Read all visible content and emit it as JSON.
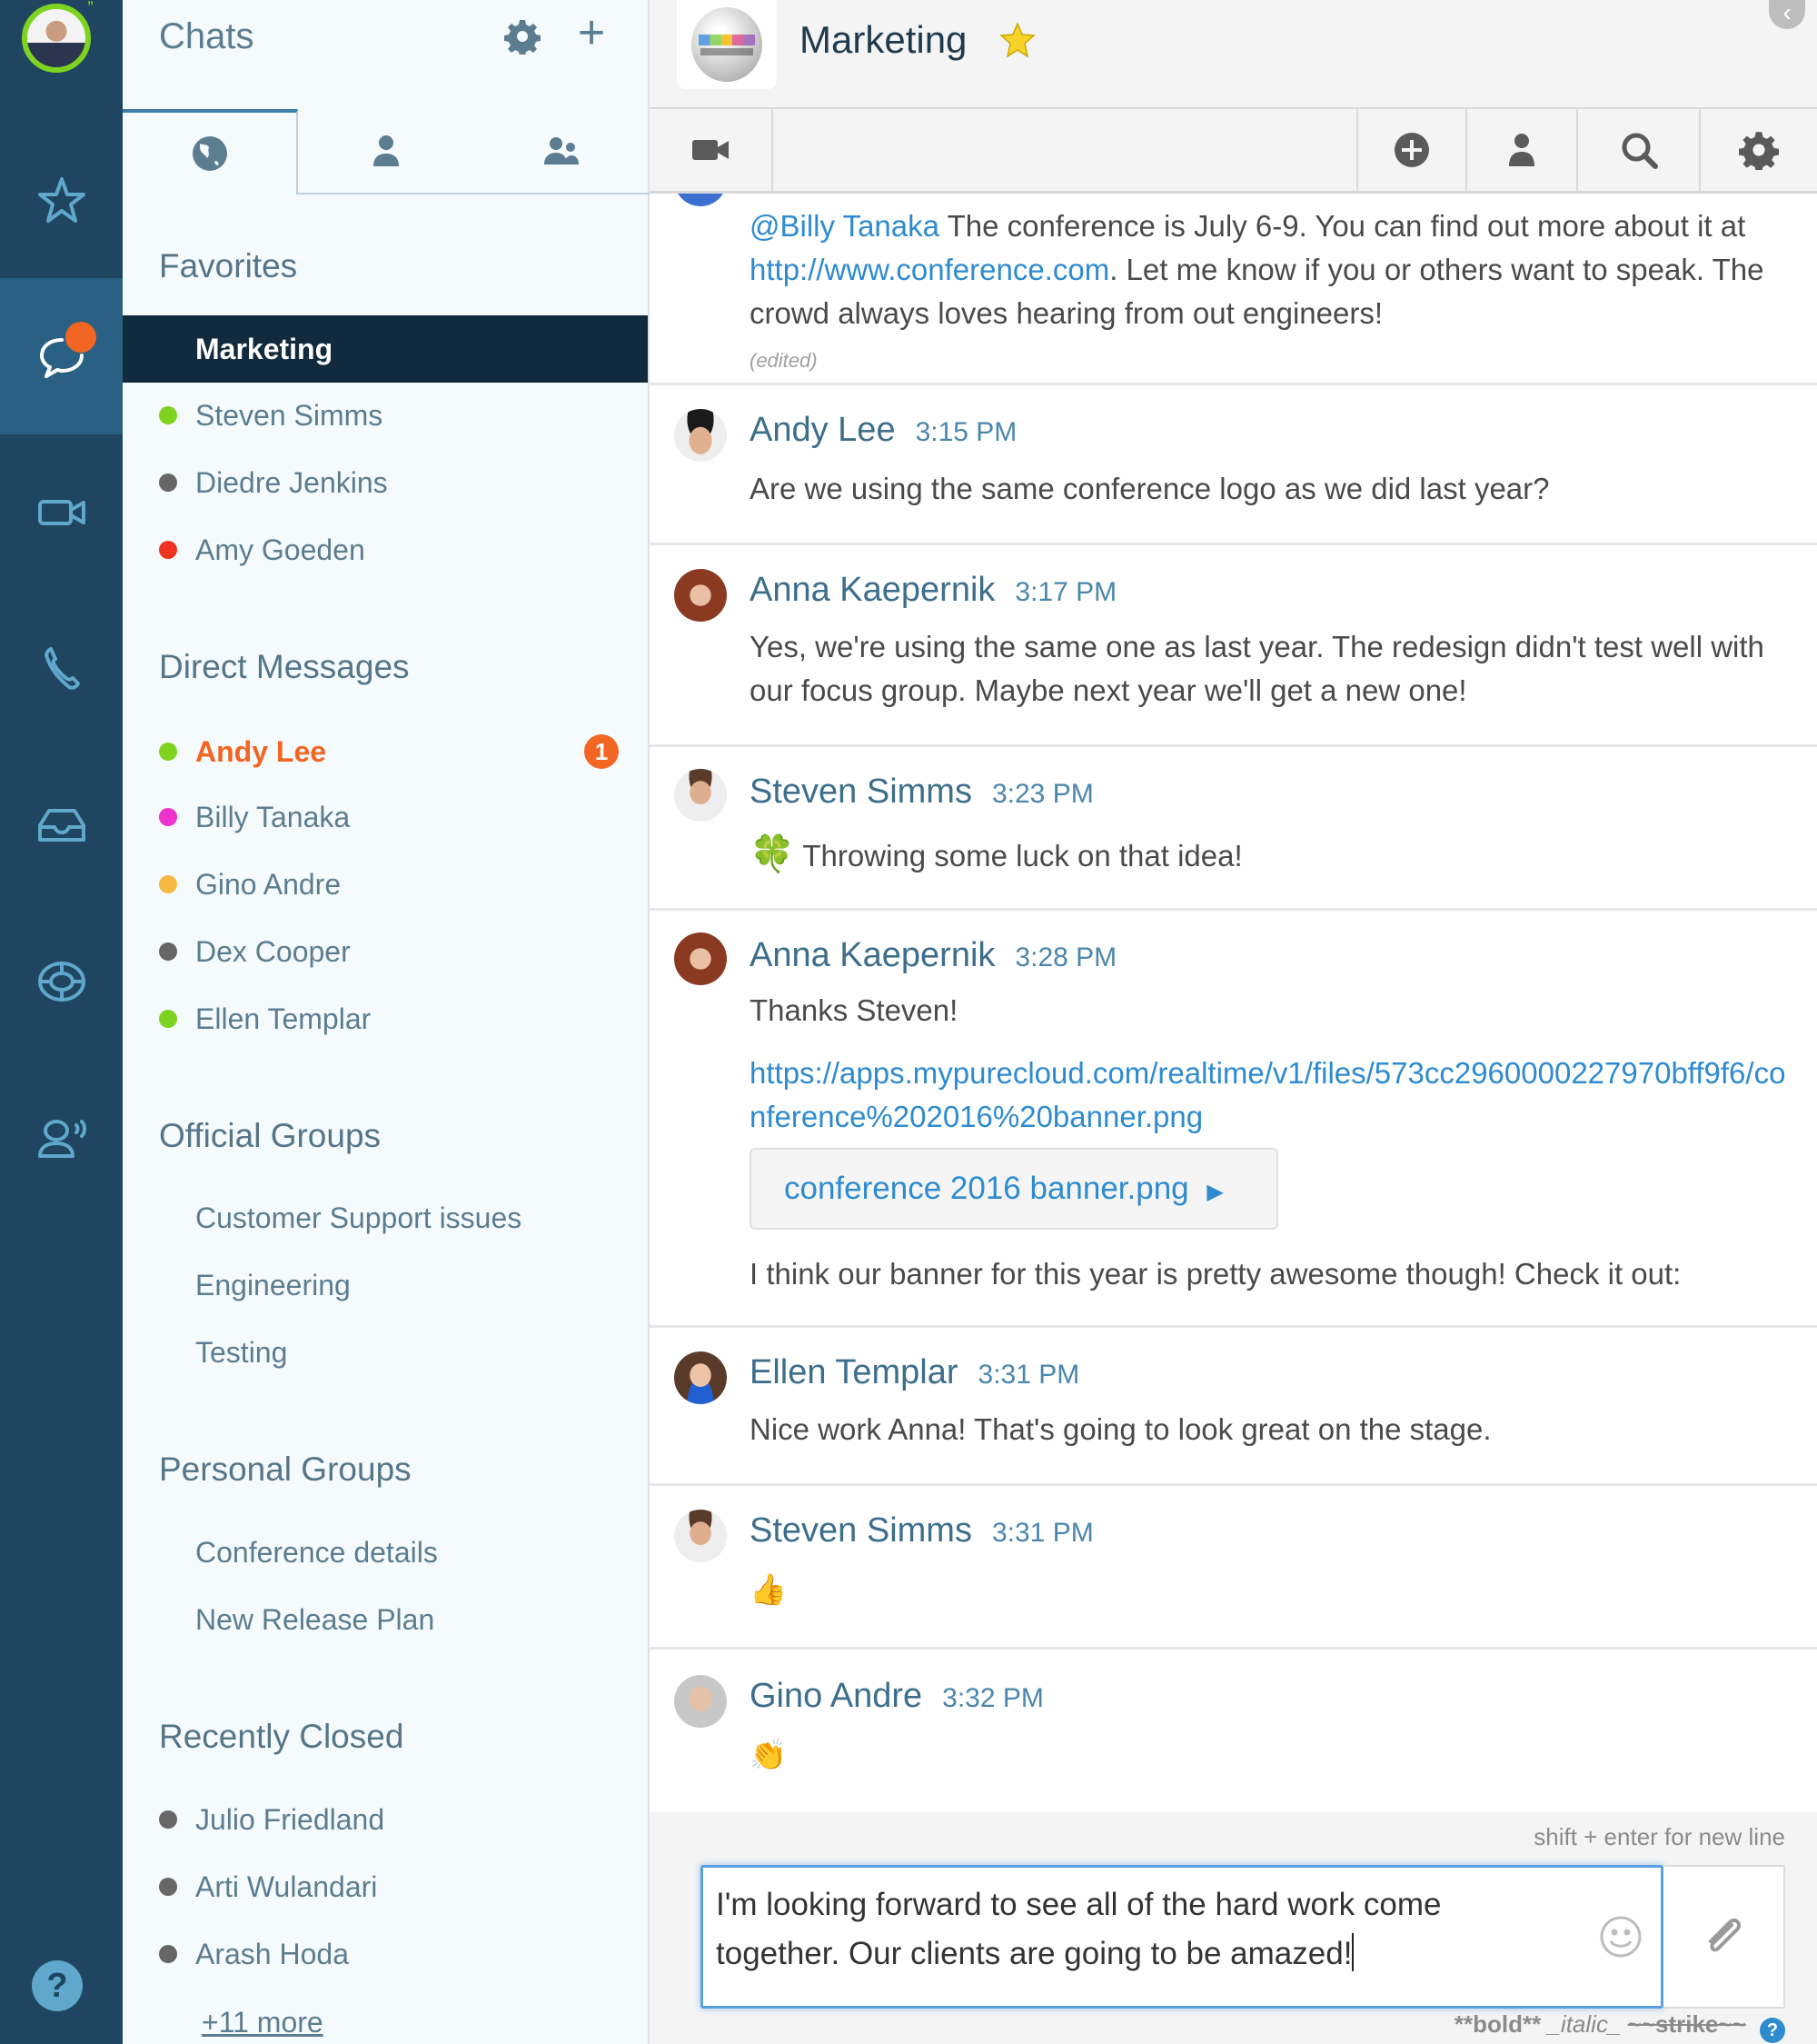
{
  "colors": {
    "rail_bg": "#1f4560",
    "rail_active": "#2a6084",
    "sidebar_bg": "#f5fafd",
    "selected_row": "#122a3d",
    "accent_orange": "#f26522",
    "link_blue": "#2e8bd0",
    "presence_available": "#7ed321",
    "presence_offline": "#666666",
    "presence_busy": "#ee3322",
    "presence_meal": "#f5b942",
    "presence_custom": "#ee33cc"
  },
  "rail": {
    "items": [
      {
        "name": "favorites",
        "icon": "star-icon"
      },
      {
        "name": "chats",
        "icon": "chat-bubble-icon",
        "active": true,
        "has_notification": true
      },
      {
        "name": "video",
        "icon": "video-camera-icon"
      },
      {
        "name": "phone",
        "icon": "phone-icon"
      },
      {
        "name": "inbox",
        "icon": "inbox-tray-icon"
      },
      {
        "name": "support",
        "icon": "lifebuoy-icon"
      },
      {
        "name": "voice-user",
        "icon": "user-speaking-icon"
      }
    ],
    "help_label": "?"
  },
  "sidebar": {
    "title": "Chats",
    "tabs": [
      {
        "icon": "globe-icon",
        "active": true
      },
      {
        "icon": "person-icon"
      },
      {
        "icon": "people-icon"
      }
    ],
    "sections": [
      {
        "title": "Favorites",
        "items": [
          {
            "label": "Marketing",
            "selected": true
          },
          {
            "label": "Steven Simms",
            "presence": "#7ed321"
          },
          {
            "label": "Diedre Jenkins",
            "presence": "#666666"
          },
          {
            "label": "Amy Goeden",
            "presence": "#ee3322"
          }
        ]
      },
      {
        "title": "Direct Messages",
        "items": [
          {
            "label": "Andy Lee",
            "presence": "#7ed321",
            "unread": true,
            "badge": "1"
          },
          {
            "label": "Billy Tanaka",
            "presence": "#ee33cc"
          },
          {
            "label": "Gino Andre",
            "presence": "#f5b942"
          },
          {
            "label": "Dex Cooper",
            "presence": "#666666"
          },
          {
            "label": "Ellen Templar",
            "presence": "#7ed321"
          }
        ]
      },
      {
        "title": "Official Groups",
        "items": [
          {
            "label": "Customer Support issues"
          },
          {
            "label": "Engineering"
          },
          {
            "label": "Testing"
          }
        ]
      },
      {
        "title": "Personal Groups",
        "items": [
          {
            "label": "Conference details"
          },
          {
            "label": "New Release Plan"
          }
        ]
      },
      {
        "title": "Recently Closed",
        "items": [
          {
            "label": "Julio Friedland",
            "presence": "#666666"
          },
          {
            "label": "Arti Wulandari",
            "presence": "#666666"
          },
          {
            "label": "Arash Hoda",
            "presence": "#666666"
          }
        ]
      }
    ],
    "more_link": "+11 more"
  },
  "header": {
    "title": "Marketing",
    "favorited": true,
    "collapse_label": "‹"
  },
  "toolbar": {
    "buttons": [
      "video-icon",
      "add-circle-icon",
      "person-icon",
      "search-icon",
      "gear-icon"
    ]
  },
  "messages": [
    {
      "author": "",
      "time": "",
      "mention": "@Billy Tanaka",
      "text_1": " The conference is July 6-9. You can find out more about it at ",
      "link": "http://www.conference.com",
      "text_2": ". Let me know if you or others want to speak. The crowd always loves hearing from out engineers!",
      "edited": "(edited)"
    },
    {
      "author": "Andy Lee",
      "time": "3:15 PM",
      "text": "Are we using the same conference logo as we did last year?"
    },
    {
      "author": "Anna Kaepernik",
      "time": "3:17 PM",
      "text": "Yes, we're using the same one as last year. The redesign didn't test well with our focus group. Maybe next year we'll get a new one!"
    },
    {
      "author": "Steven Simms",
      "time": "3:23 PM",
      "emoji": "🍀",
      "text": "Throwing some luck on that idea!"
    },
    {
      "author": "Anna Kaepernik",
      "time": "3:28 PM",
      "text": "Thanks Steven!",
      "link": "https://apps.mypurecloud.com/realtime/v1/files/573cc2960000227970bff9f6/conference%202016%20banner.png",
      "file_name": "conference 2016 banner.png",
      "text_after": "I think our banner for this year is pretty awesome though! Check it out:"
    },
    {
      "author": "Ellen Templar",
      "time": "3:31 PM",
      "text": "Nice work Anna! That's going to look great on the stage."
    },
    {
      "author": "Steven Simms",
      "time": "3:31 PM",
      "emoji": "👍"
    },
    {
      "author": "Gino Andre",
      "time": "3:32 PM",
      "emoji": "👏"
    }
  ],
  "composer": {
    "hint": "shift + enter for new line",
    "value": "I'm looking forward to see all of the hard work come together. Our clients are going to be amazed!",
    "format_bold": "**bold**",
    "format_italic": "_italic_",
    "format_strike": "~~strike~~",
    "format_help": "?"
  }
}
